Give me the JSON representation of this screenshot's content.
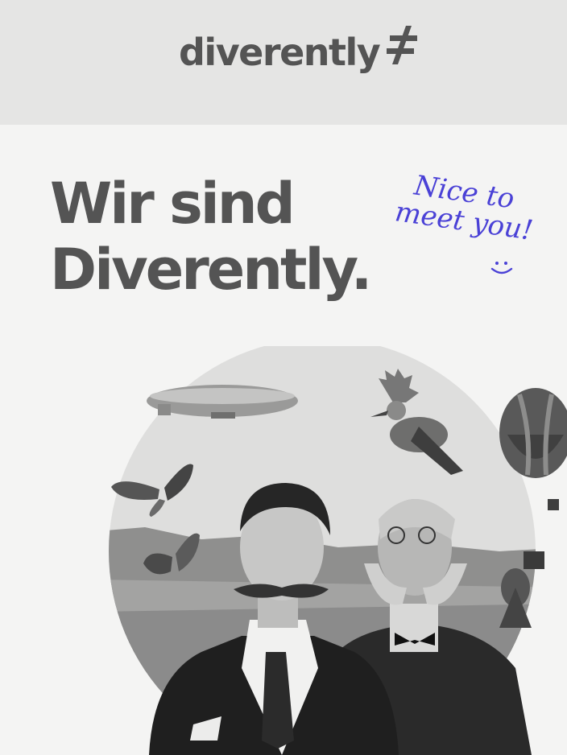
{
  "header": {
    "logo_text": "diverently",
    "logo_mark_icon": "not-equal-icon"
  },
  "hero": {
    "headline_line1": "Wir sind",
    "headline_line2": "Diverently."
  },
  "greeting": {
    "line1": "Nice to",
    "line2": "meet you!",
    "emoticon": "smiley-icon"
  },
  "collage": {
    "items": [
      "circle-backdrop",
      "landscape",
      "zeppelin",
      "butterfly",
      "butterfly",
      "hoopoe-bird",
      "hot-air-balloon",
      "man-with-mustache",
      "older-man-with-sideburns",
      "camera-operator"
    ]
  },
  "colors": {
    "brand_gray": "#545454",
    "accent_blue": "#4a41d6",
    "header_bg": "#e5e5e4",
    "page_bg": "#f4f4f3"
  }
}
